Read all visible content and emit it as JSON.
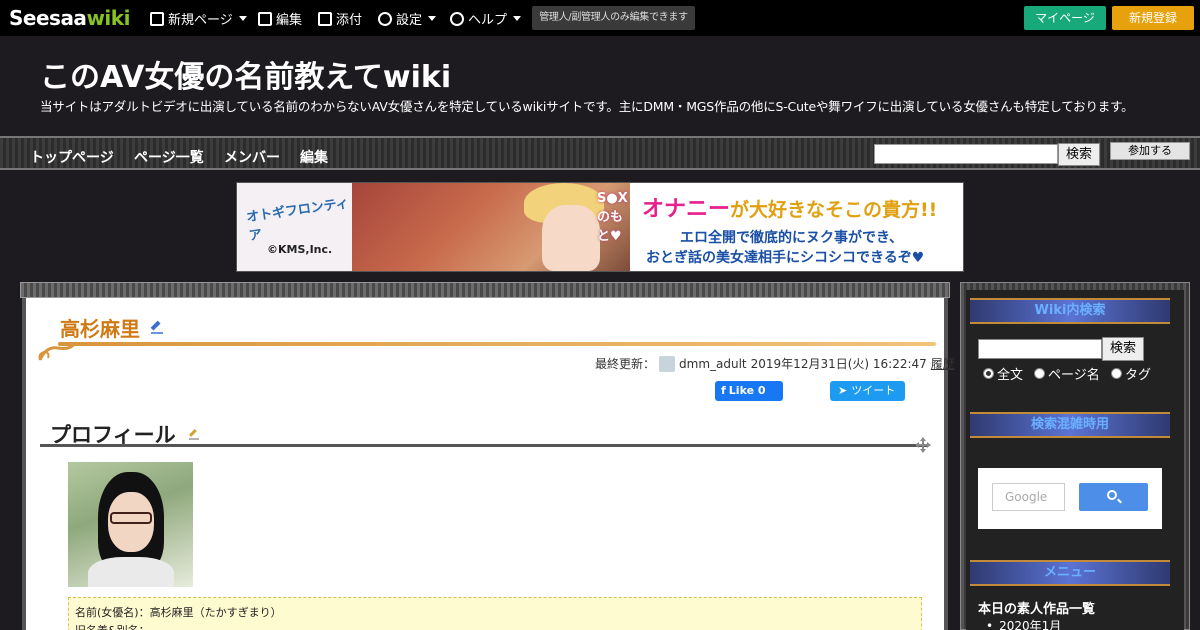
{
  "topbar": {
    "logo_part1": "Seesaa",
    "logo_part2": "wiki",
    "menu": [
      {
        "label": "新規ページ",
        "icon": "page-icon",
        "dropdown": true
      },
      {
        "label": "編集",
        "icon": "edit-icon",
        "dropdown": false
      },
      {
        "label": "添付",
        "icon": "image-icon",
        "dropdown": false
      },
      {
        "label": "設定",
        "icon": "gear-icon",
        "dropdown": true
      },
      {
        "label": "ヘルプ",
        "icon": "help-icon",
        "dropdown": true
      }
    ],
    "note": "管理人/副管理人のみ編集できます",
    "mypage_label": "マイページ",
    "register_label": "新規登録",
    "colors": {
      "mypage": "#17a97a",
      "register": "#e7a10c",
      "logo_accent": "#85c226"
    }
  },
  "header": {
    "title": "このAV女優の名前教えてwiki",
    "description": "当サイトはアダルトビデオに出演している名前のわからないAV女優さんを特定しているwikiサイトです。主にDMM・MGS作品の他にS-Cuteや舞ワイフに出演している女優さんも特定しております。"
  },
  "navbar": {
    "items": [
      "トップページ",
      "ページ一覧",
      "メンバー",
      "編集"
    ],
    "search_button": "検索",
    "join_button": "参加する"
  },
  "banner": {
    "left_logo": "オトギフロンティア",
    "left_copyright": "©KMS,Inc.",
    "mid_text": "S●Xのもと♥",
    "right_line1_a": "オナニー",
    "right_line1_b": "が大好きなそこの貴方!!",
    "right_line2": "エロ全開で徹底的にヌク事ができ、",
    "right_line3": "おとぎ話の美女達相手にシコシコできるぞ♥"
  },
  "page": {
    "title": "高杉麻里",
    "updated_label": "最終更新：",
    "updated_user": "dmm_adult",
    "updated_date": "2019年12月31日(火) 16:22:47",
    "history_label": "履歴",
    "like_label": "Like 0",
    "tweet_label": "ツイート",
    "section_title": "プロフィール",
    "profile_line1": "名前(女優名)：高杉麻里（たかすぎまり）",
    "profile_line2": "旧名義&別名：",
    "title_color": "#d07a15"
  },
  "sidebar": {
    "search_head": "Wiki内検索",
    "search_button": "検索",
    "radios": [
      {
        "label": "全文",
        "checked": true
      },
      {
        "label": "ページ名",
        "checked": false
      },
      {
        "label": "タグ",
        "checked": false
      }
    ],
    "busy_head": "検索混雑時用",
    "google_label": "Google",
    "menu_head": "メニュー",
    "daily_label": "本日の素人作品一覧",
    "month_item": "2020年1月"
  }
}
